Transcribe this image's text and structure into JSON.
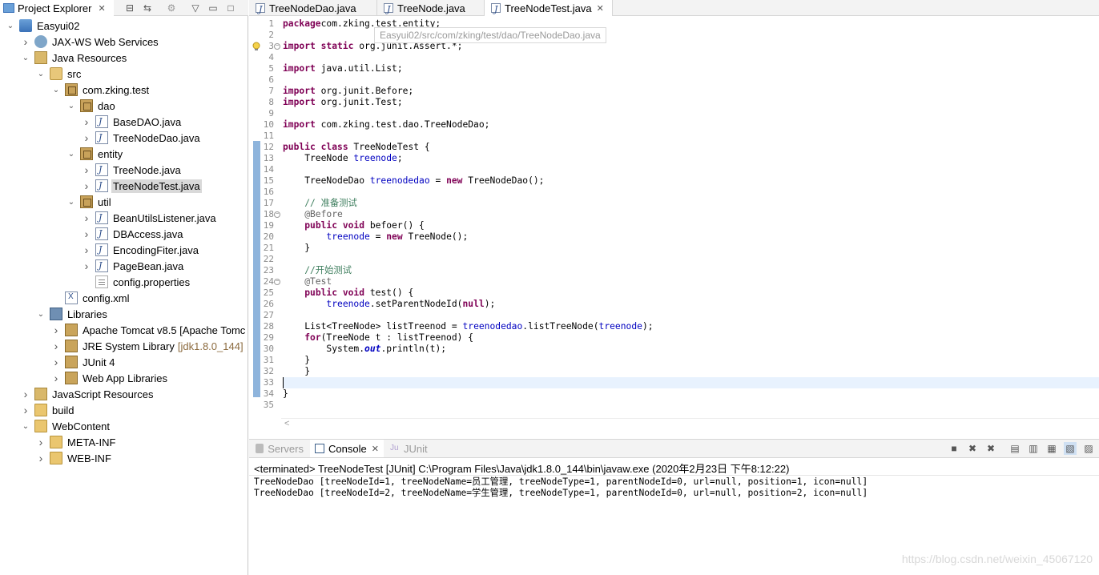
{
  "explorer": {
    "title": "Project Explorer",
    "tree": [
      {
        "label": "Easyui02",
        "icon": "project-icon",
        "depth": 0,
        "state": "open"
      },
      {
        "label": "JAX-WS Web Services",
        "icon": "web-services-icon",
        "depth": 1,
        "state": "closed"
      },
      {
        "label": "Java Resources",
        "icon": "java-resources-icon",
        "depth": 1,
        "state": "open"
      },
      {
        "label": "src",
        "icon": "source-folder-icon",
        "depth": 2,
        "state": "open"
      },
      {
        "label": "com.zking.test",
        "icon": "package-icon",
        "depth": 3,
        "state": "open"
      },
      {
        "label": "dao",
        "icon": "package-icon",
        "depth": 4,
        "state": "open"
      },
      {
        "label": "BaseDAO.java",
        "icon": "java-file-icon",
        "depth": 5,
        "state": "closed"
      },
      {
        "label": "TreeNodeDao.java",
        "icon": "java-file-icon",
        "depth": 5,
        "state": "closed"
      },
      {
        "label": "entity",
        "icon": "package-icon",
        "depth": 4,
        "state": "open"
      },
      {
        "label": "TreeNode.java",
        "icon": "java-file-icon",
        "depth": 5,
        "state": "closed"
      },
      {
        "label": "TreeNodeTest.java",
        "icon": "java-file-icon",
        "depth": 5,
        "state": "closed",
        "selected": true
      },
      {
        "label": "util",
        "icon": "package-icon",
        "depth": 4,
        "state": "open"
      },
      {
        "label": "BeanUtilsListener.java",
        "icon": "java-file-icon",
        "depth": 5,
        "state": "closed"
      },
      {
        "label": "DBAccess.java",
        "icon": "java-file-icon",
        "depth": 5,
        "state": "closed"
      },
      {
        "label": "EncodingFiter.java",
        "icon": "java-file-icon",
        "depth": 5,
        "state": "closed"
      },
      {
        "label": "PageBean.java",
        "icon": "java-file-icon",
        "depth": 5,
        "state": "closed"
      },
      {
        "label": "config.properties",
        "icon": "properties-file-icon",
        "depth": 5,
        "state": "none"
      },
      {
        "label": "config.xml",
        "icon": "xml-file-icon",
        "depth": 3,
        "state": "none"
      },
      {
        "label": "Libraries",
        "icon": "libraries-icon",
        "depth": 2,
        "state": "open"
      },
      {
        "label": "Apache Tomcat v8.5 [Apache Tomc",
        "icon": "library-icon",
        "depth": 3,
        "state": "closed"
      },
      {
        "label": "JRE System Library",
        "suffix": "[jdk1.8.0_144]",
        "icon": "library-icon",
        "depth": 3,
        "state": "closed"
      },
      {
        "label": "JUnit 4",
        "icon": "library-icon",
        "depth": 3,
        "state": "closed"
      },
      {
        "label": "Web App Libraries",
        "icon": "library-icon",
        "depth": 3,
        "state": "closed"
      },
      {
        "label": "JavaScript Resources",
        "icon": "javascript-resources-icon",
        "depth": 1,
        "state": "closed"
      },
      {
        "label": "build",
        "icon": "folder-icon",
        "depth": 1,
        "state": "closed"
      },
      {
        "label": "WebContent",
        "icon": "folder-icon",
        "depth": 1,
        "state": "open"
      },
      {
        "label": "META-INF",
        "icon": "folder-icon",
        "depth": 2,
        "state": "closed"
      },
      {
        "label": "WEB-INF",
        "icon": "folder-icon",
        "depth": 2,
        "state": "closed"
      }
    ]
  },
  "editor": {
    "tabs": [
      {
        "label": "TreeNodeDao.java",
        "active": false
      },
      {
        "label": "TreeNode.java",
        "active": false
      },
      {
        "label": "TreeNodeTest.java",
        "active": true
      }
    ],
    "tooltip": "Easyui02/src/com/zking/test/dao/TreeNodeDao.java",
    "lines": [
      [
        [
          "kw",
          "package"
        ],
        [
          "",
          "com.zking.test.entity;"
        ]
      ],
      [],
      [
        [
          "kw",
          "import static"
        ],
        [
          "",
          " org.junit.Assert.*;"
        ]
      ],
      [],
      [
        [
          "kw",
          "import"
        ],
        [
          "",
          " java.util.List;"
        ]
      ],
      [],
      [
        [
          "kw",
          "import"
        ],
        [
          "",
          " org.junit.Before;"
        ]
      ],
      [
        [
          "kw",
          "import"
        ],
        [
          "",
          " org.junit.Test;"
        ]
      ],
      [],
      [
        [
          "kw",
          "import"
        ],
        [
          "",
          " com.zking.test.dao.TreeNodeDao;"
        ]
      ],
      [],
      [
        [
          "kw",
          "public class"
        ],
        [
          "",
          " TreeNodeTest {"
        ]
      ],
      [
        [
          "",
          "    TreeNode "
        ],
        [
          "fld",
          "treenode"
        ],
        [
          "",
          ";"
        ]
      ],
      [],
      [
        [
          "",
          "    TreeNodeDao "
        ],
        [
          "fld",
          "treenodedao"
        ],
        [
          "",
          " = "
        ],
        [
          "kw",
          "new"
        ],
        [
          "",
          " TreeNodeDao();"
        ]
      ],
      [],
      [
        [
          "cmt",
          "    // 准备测试"
        ]
      ],
      [
        [
          "ann",
          "    @Before"
        ]
      ],
      [
        [
          "",
          "    "
        ],
        [
          "kw",
          "public void"
        ],
        [
          "",
          " befoer() {"
        ]
      ],
      [
        [
          "",
          "        "
        ],
        [
          "fld",
          "treenode"
        ],
        [
          "",
          " = "
        ],
        [
          "kw",
          "new"
        ],
        [
          "",
          " TreeNode();"
        ]
      ],
      [
        [
          "",
          "    }"
        ]
      ],
      [],
      [
        [
          "cmt",
          "    //开始测试"
        ]
      ],
      [
        [
          "ann",
          "    @Test"
        ]
      ],
      [
        [
          "",
          "    "
        ],
        [
          "kw",
          "public void"
        ],
        [
          "",
          " test() {"
        ]
      ],
      [
        [
          "",
          "        "
        ],
        [
          "fld",
          "treenode"
        ],
        [
          "",
          ".setParentNodeId("
        ],
        [
          "kw",
          "null"
        ],
        [
          "",
          ");"
        ]
      ],
      [],
      [
        [
          "",
          "    List<TreeNode> "
        ],
        [
          "",
          "listTreenod"
        ],
        [
          "",
          " = "
        ],
        [
          "fld",
          "treenodedao"
        ],
        [
          "",
          ".listTreeNode("
        ],
        [
          "fld",
          "treenode"
        ],
        [
          "",
          ");"
        ]
      ],
      [
        [
          "",
          "    "
        ],
        [
          "kw",
          "for"
        ],
        [
          "",
          "(TreeNode t : listTreenod) {"
        ]
      ],
      [
        [
          "",
          "        System."
        ],
        [
          "sf",
          "out"
        ],
        [
          "",
          ".println(t);"
        ]
      ],
      [
        [
          "",
          "    }"
        ]
      ],
      [
        [
          "",
          "    }"
        ]
      ],
      [],
      [
        [
          "",
          "}"
        ]
      ],
      []
    ]
  },
  "console": {
    "tabs": [
      {
        "label": "Servers",
        "active": false
      },
      {
        "label": "Console",
        "active": true
      },
      {
        "label": "JUnit",
        "active": false
      }
    ],
    "status": "<terminated> TreeNodeTest [JUnit] C:\\Program Files\\Java\\jdk1.8.0_144\\bin\\javaw.exe (2020年2月23日 下午8:12:22)",
    "output": [
      "TreeNodeDao [treeNodeId=1, treeNodeName=员工管理, treeNodeType=1, parentNodeId=0, url=null, position=1, icon=null]",
      "TreeNodeDao [treeNodeId=2, treeNodeName=学生管理, treeNodeType=1, parentNodeId=0, url=null, position=2, icon=null]"
    ]
  },
  "watermark": "https://blog.csdn.net/weixin_45067120"
}
